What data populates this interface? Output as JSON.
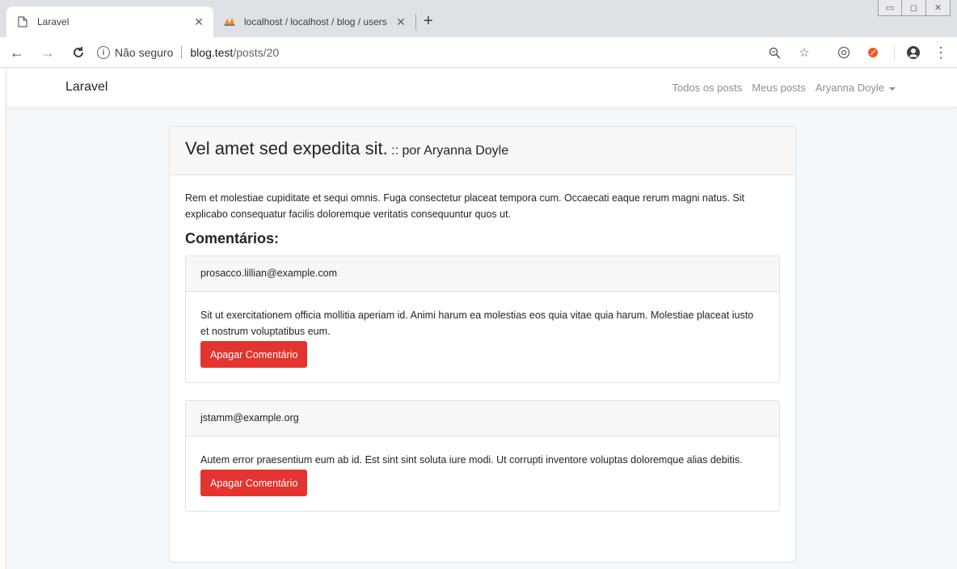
{
  "browser": {
    "tabs": [
      {
        "title": "Laravel",
        "close": "✕"
      },
      {
        "title": "localhost / localhost / blog / users",
        "close": "✕"
      }
    ],
    "new_tab": "+",
    "address": {
      "security_label": "Não seguro",
      "host": "blog.test",
      "path": "/posts/20"
    }
  },
  "navbar": {
    "brand": "Laravel",
    "links": [
      "Todos os posts",
      "Meus posts"
    ],
    "user": "Aryanna Doyle"
  },
  "post": {
    "title": "Vel amet sed expedita sit.",
    "separator": "::",
    "author_prefix": "por",
    "author": "Aryanna Doyle",
    "body": "Rem et molestiae cupiditate et sequi omnis. Fuga consectetur placeat tempora cum. Occaecati eaque rerum magni natus. Sit explicabo consequatur facilis doloremque veritatis consequuntur quos ut."
  },
  "comments_heading": "Comentários:",
  "comments": [
    {
      "email": "prosacco.lillian@example.com",
      "text": "Sit ut exercitationem officia mollitia aperiam id. Animi harum ea molestias eos quia vitae quia harum. Molestiae placeat iusto et nostrum voluptatibus eum.",
      "delete_label": "Apagar Comentário"
    },
    {
      "email": "jstamm@example.org",
      "text": "Autem error praesentium eum ab id. Est sint sint soluta iure modi. Ut corrupti inventore voluptas doloremque alias debitis.",
      "delete_label": "Apagar Comentário"
    }
  ],
  "colors": {
    "danger": "#e3342f",
    "page_bg": "#f5f8fa"
  }
}
